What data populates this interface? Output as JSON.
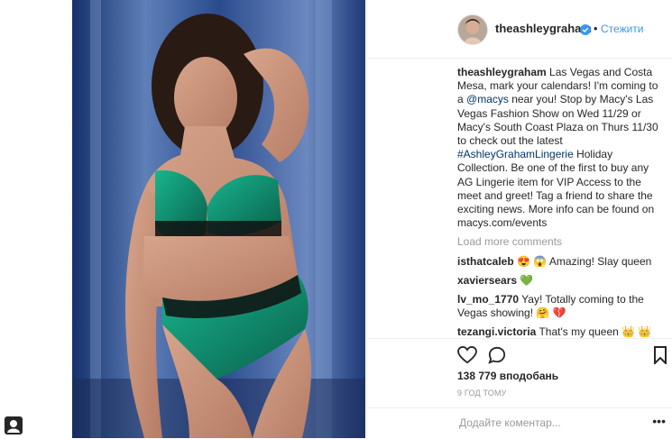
{
  "post": {
    "username": "theashleygraham",
    "follow_label": "Стежити",
    "dot": "•",
    "caption_user": "theashleygraham",
    "caption_part1": " Las Vegas and Costa Mesa, mark your calendars! I'm coming to a ",
    "caption_mention": "@macys",
    "caption_part2": " near you! Stop by Macy's Las Vegas Fashion Show on Wed 11/29 or Macy's South Coast Plaza on Thurs 11/30 to check out the latest ",
    "caption_hashtag": "#AshleyGrahamLingerie",
    "caption_part3": " Holiday Collection. Be one of the first to buy any AG Lingerie item for VIP Access to the meet and greet! Tag a friend to share the exciting news. More info can be found on macys.com/events",
    "load_more": "Load more comments",
    "likes": "138 779 вподобань",
    "time": "9 ГОД ТОМУ",
    "comment_placeholder": "Додайте коментар...",
    "more": "•••"
  },
  "comments": [
    {
      "user": "isthatcaleb",
      "text": " 😍 😱 Amazing! Slay queen"
    },
    {
      "user": "xaviersears",
      "text": " 💚"
    },
    {
      "user": "lv_mo_1770",
      "text": " Yay! Totally coming to the Vegas showing! 🤗 💔"
    },
    {
      "user": "tezangi.victoria",
      "text": " That's my queen 👑 👑 👑 😍 😍"
    }
  ],
  "icons": {
    "heart": "heart-icon",
    "comment": "comment-icon",
    "bookmark": "bookmark-icon",
    "verified": "verified-icon",
    "user": "user-icon"
  },
  "colors": {
    "link": "#003569",
    "follow": "#3897f0",
    "muted": "#999999",
    "lingerie": "#0f8a6e"
  }
}
